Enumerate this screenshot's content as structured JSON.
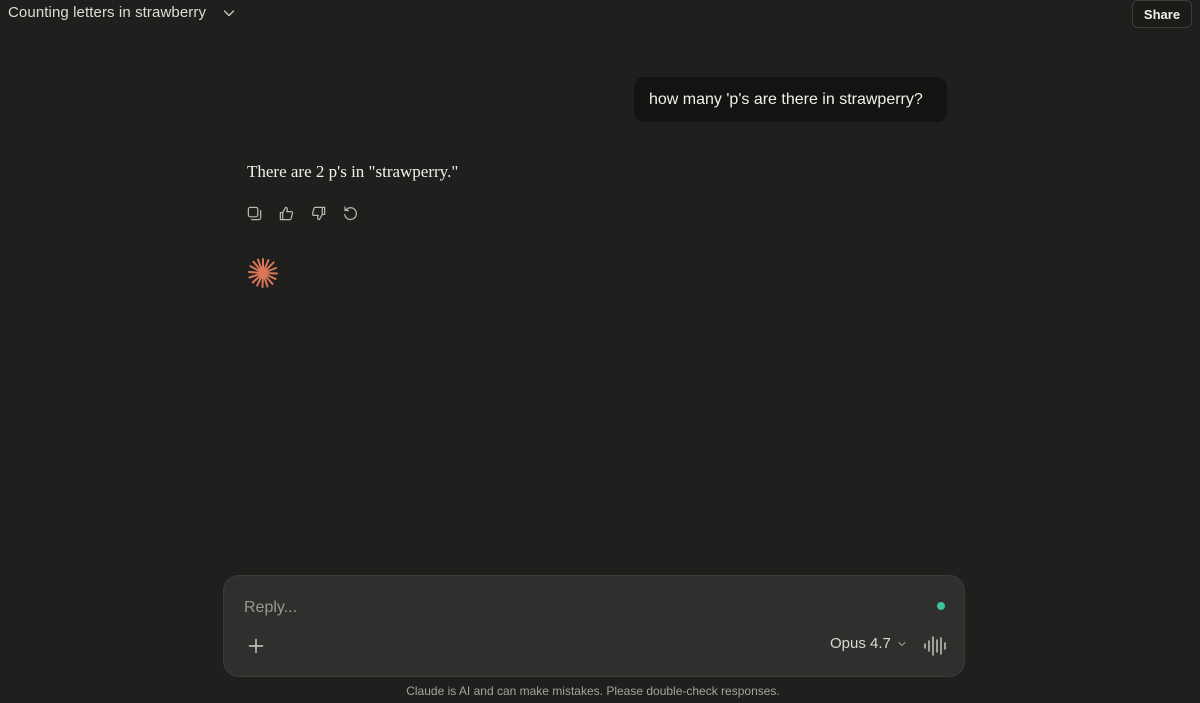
{
  "header": {
    "chat_title": "Counting letters in strawberry",
    "share_label": "Share"
  },
  "conversation": {
    "user_message": "how many 'p's are there in strawperry?",
    "assistant_message": "There are 2 p's in \"strawperry.\"",
    "message_actions": [
      "copy-icon",
      "thumbs-up-icon",
      "thumbs-down-icon",
      "retry-icon"
    ]
  },
  "composer": {
    "placeholder": "Reply...",
    "model_label": "Opus 4.7",
    "status_color": "#3fc0a0"
  },
  "footer": {
    "disclaimer": "Claude is AI and can make mistakes. Please double-check responses."
  },
  "colors": {
    "background": "#1f1f1e",
    "accent_spark": "#d97757"
  }
}
